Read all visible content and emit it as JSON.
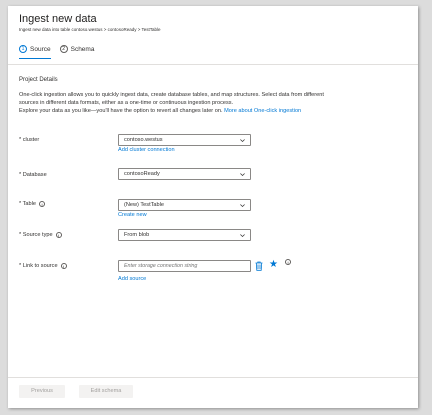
{
  "header": {
    "title": "Ingest new data",
    "subtitle": "Ingest new data into table contoso.westus > contosoReady > TestTable"
  },
  "tabs": [
    {
      "number": "1",
      "label": "Source",
      "active": true
    },
    {
      "number": "2",
      "label": "Schema",
      "active": false
    }
  ],
  "project": {
    "section_title": "Project Details",
    "description_line1": "One-click ingestion allows you to quickly ingest data, create database tables, and map structures. Select data from different",
    "description_line2": "sources in different data formats, either as a one-time or continuous ingestion process.",
    "description_line3": "Explore your data as you like—you'll have the option to revert all changes later on.",
    "description_link": "More about One-click ingestion"
  },
  "fields": {
    "cluster": {
      "label": "* cluster",
      "value": "contoso.westus",
      "link": "Add cluster connection"
    },
    "database": {
      "label": "* Database",
      "value": "contosoReady"
    },
    "table": {
      "label": "* Table",
      "value": "(New) TestTable",
      "link": "Create new"
    },
    "source_type": {
      "label": "* Source type",
      "value": "From blob"
    },
    "link_to_source": {
      "label": "* Link to source",
      "placeholder": "Enter storage connection string",
      "link": "Add source"
    }
  },
  "footer": {
    "previous_label": "Previous",
    "edit_schema_label": "Edit schema"
  },
  "colors": {
    "accent": "#0078d4",
    "text": "#323130",
    "border": "#8a8886",
    "disabled_bg": "#f3f2f1",
    "disabled_text": "#a19f9d"
  },
  "icons": [
    "info-icon",
    "chevron-down-icon",
    "trash-icon",
    "star-icon"
  ]
}
